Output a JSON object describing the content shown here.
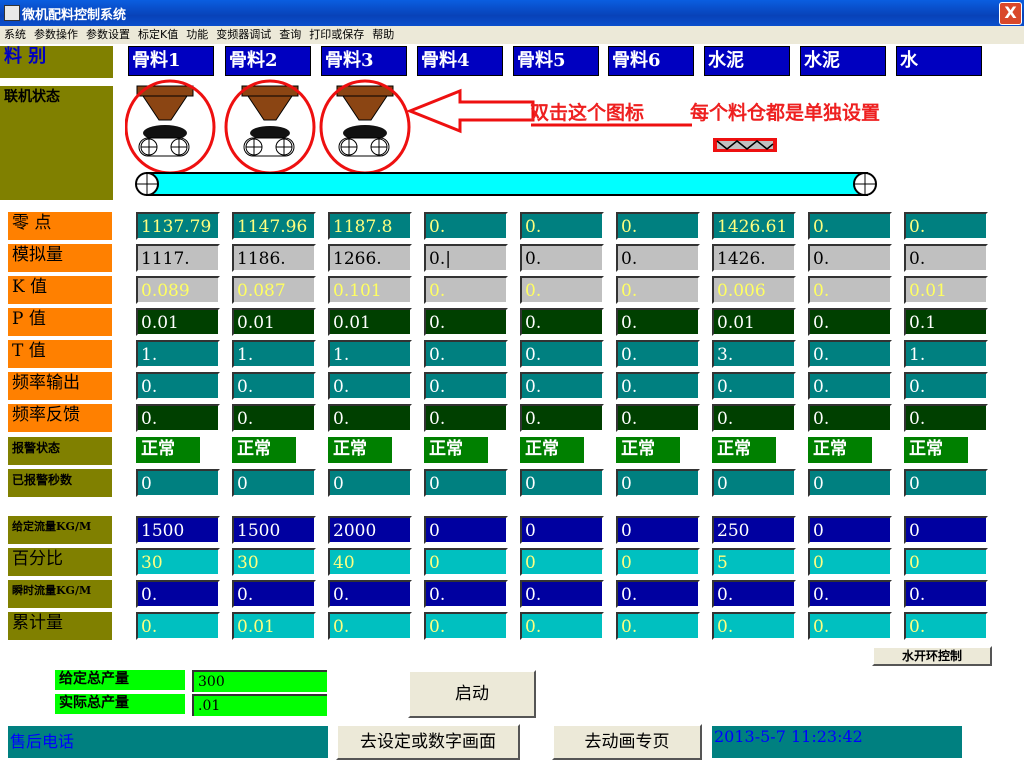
{
  "window": {
    "title": "微机配料控制系统",
    "close_glyph": "X"
  },
  "menu": [
    "系统",
    "参数操作",
    "参数设置",
    "标定K值",
    "功能",
    "变频器调试",
    "查询",
    "打印或保存",
    "帮助"
  ],
  "labels": {
    "material": "料  别",
    "online_status": "联机状态",
    "zero": "零  点",
    "analog": "模拟量",
    "k": "K  值",
    "p": "P  值",
    "t": "T  值",
    "freq_out": "频率输出",
    "freq_fb": "频率反馈",
    "alarm_status": "报警状态",
    "alarm_seconds": "已报警秒数",
    "set_flow": "给定流量KG/M",
    "percent": "百分比",
    "instant_flow": "瞬时流量KG/M",
    "cumulative": "累计量"
  },
  "materials": [
    "骨料1",
    "骨料2",
    "骨料3",
    "骨料4",
    "骨料5",
    "骨料6",
    "水泥",
    "水泥",
    "水"
  ],
  "annotation": {
    "left": "双击这个图标",
    "right": "每个料仓都是单独设置"
  },
  "rows": {
    "zero": [
      "1137.79",
      "1147.96",
      "1187.8",
      "0.",
      "0.",
      "0.",
      "1426.61",
      "0.",
      "0."
    ],
    "analog": [
      "1117.",
      "1186.",
      "1266.",
      "0.|",
      "0.",
      "0.",
      "1426.",
      "0.",
      "0."
    ],
    "k": [
      "0.089",
      "0.087",
      "0.101",
      "0.",
      "0.",
      "0.",
      "0.006",
      "0.",
      "0.01"
    ],
    "p": [
      "0.01",
      "0.01",
      "0.01",
      "0.",
      "0.",
      "0.",
      "0.01",
      "0.",
      "0.1"
    ],
    "t": [
      "1.",
      "1.",
      "1.",
      "0.",
      "0.",
      "0.",
      "3.",
      "0.",
      "1."
    ],
    "freq_out": [
      "0.",
      "0.",
      "0.",
      "0.",
      "0.",
      "0.",
      "0.",
      "0.",
      "0."
    ],
    "freq_fb": [
      "0.",
      "0.",
      "0.",
      "0.",
      "0.",
      "0.",
      "0.",
      "0.",
      "0."
    ],
    "alarm_status": [
      "正常",
      "正常",
      "正常",
      "正常",
      "正常",
      "正常",
      "正常",
      "正常",
      "正常"
    ],
    "alarm_seconds": [
      "0",
      "0",
      "0",
      "0",
      "0",
      "0",
      "0",
      "0",
      "0"
    ],
    "set_flow": [
      "1500",
      "1500",
      "2000",
      "0",
      "0",
      "0",
      "250",
      "0",
      "0"
    ],
    "percent": [
      "30",
      "30",
      "40",
      "0",
      "0",
      "0",
      "5",
      "0",
      "0"
    ],
    "instant_flow": [
      "0.",
      "0.",
      "0.",
      "0.",
      "0.",
      "0.",
      "0.",
      "0.",
      "0."
    ],
    "cumulative": [
      "0.",
      "0.01",
      "0.",
      "0.",
      "0.",
      "0.",
      "0.",
      "0.",
      "0."
    ]
  },
  "water_loop_button": "水开环控制",
  "totals": {
    "set_label": "给定总产量",
    "set_value": "300",
    "actual_label": "实际总产量",
    "actual_value": ".01"
  },
  "start_button": "启动",
  "service_phone": "售后电话",
  "goto_settings_button": "去设定或数字画面",
  "goto_animation_button": "去动画专页",
  "datetime": "2013-5-7  11:23:42",
  "colors": {
    "annotation_red": "#ee2020",
    "label_olive": "#808000",
    "label_orange": "#ff8000",
    "material_blue": "#0000c0"
  }
}
